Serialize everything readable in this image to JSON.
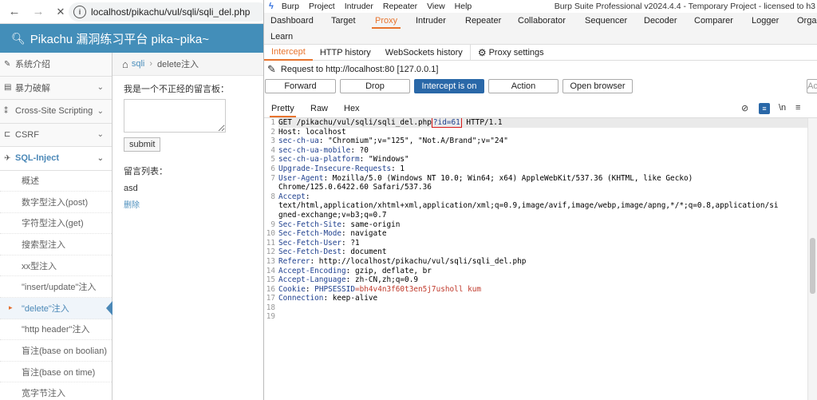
{
  "browser": {
    "back_icon": "←",
    "forward_icon": "→",
    "close_icon": "✕",
    "url": "localhost/pikachu/vul/sqli/sqli_del.php"
  },
  "site": {
    "title": "Pikachu 漏洞练习平台 pika~pika~",
    "sidebar": [
      {
        "label": "系统介绍",
        "icon": "✎",
        "chevron": false
      },
      {
        "label": "暴力破解",
        "icon": "▤",
        "chevron": true
      },
      {
        "label": "Cross-Site Scripting",
        "icon": "⁑",
        "chevron": true
      },
      {
        "label": "CSRF",
        "icon": "⊏",
        "chevron": true
      },
      {
        "label": "SQL-Inject",
        "icon": "✈",
        "chevron": true,
        "active": true
      }
    ],
    "sql_subitems": [
      "概述",
      "数字型注入(post)",
      "字符型注入(get)",
      "搜索型注入",
      "xx型注入",
      "\"insert/update\"注入",
      "\"delete\"注入",
      "\"http header\"注入",
      "盲注(base on boolian)",
      "盲注(base on time)",
      "宽字节注入"
    ],
    "breadcrumb": {
      "link": "sqli",
      "sep": "›",
      "current": "delete注入"
    },
    "form_label": "我是一个不正经的留言板：",
    "submit_label": "submit",
    "list_label": "留言列表：",
    "entry_text": "asd",
    "delete_link": "删除"
  },
  "burp": {
    "menu": [
      "Burp",
      "Project",
      "Intruder",
      "Repeater",
      "View",
      "Help"
    ],
    "window_title": "Burp Suite Professional v2024.4.4 - Temporary Project - licensed to h3",
    "top_tabs": [
      "Dashboard",
      "Target",
      "Proxy",
      "Intruder",
      "Repeater",
      "Collaborator",
      "Sequencer",
      "Decoder",
      "Comparer",
      "Logger",
      "Orga",
      "Learn"
    ],
    "active_top_tab": "Proxy",
    "sub_tabs": [
      "Intercept",
      "HTTP history",
      "WebSockets history",
      "Proxy settings"
    ],
    "request_label": "Request to http://localhost:80  [127.0.0.1]",
    "buttons": {
      "forward": "Forward",
      "drop": "Drop",
      "intercept": "Intercept is on",
      "action": "Action",
      "open_browser": "Open browser"
    },
    "view_tabs": [
      "Pretty",
      "Raw",
      "Hex"
    ],
    "view_icons": {
      "hide": "⊘",
      "wrap": "≡",
      "newline": "\\n",
      "menu": "≡"
    },
    "request_lines": [
      {
        "n": "1",
        "parts": [
          {
            "t": "GET /pikachu/vul/sqli/sqli_del.php",
            "c": "v"
          },
          {
            "t": "?id=61",
            "c": "box"
          },
          {
            "t": " HTTP/1.1",
            "c": "v"
          }
        ]
      },
      {
        "n": "2",
        "parts": [
          {
            "t": "Host: localhost",
            "c": "v"
          }
        ]
      },
      {
        "n": "3",
        "parts": [
          {
            "t": "sec-ch-ua",
            "c": "k"
          },
          {
            "t": ": \"Chromium\";v=\"125\", \"Not.A/Brand\";v=\"24\"",
            "c": "v"
          }
        ]
      },
      {
        "n": "4",
        "parts": [
          {
            "t": "sec-ch-ua-mobile",
            "c": "k"
          },
          {
            "t": ": ?0",
            "c": "v"
          }
        ]
      },
      {
        "n": "5",
        "parts": [
          {
            "t": "sec-ch-ua-platform",
            "c": "k"
          },
          {
            "t": ": \"Windows\"",
            "c": "v"
          }
        ]
      },
      {
        "n": "6",
        "parts": [
          {
            "t": "Upgrade-Insecure-Requests",
            "c": "k"
          },
          {
            "t": ": 1",
            "c": "v"
          }
        ]
      },
      {
        "n": "7",
        "parts": [
          {
            "t": "User-Agent",
            "c": "k"
          },
          {
            "t": ": Mozilla/5.0 (Windows NT 10.0; Win64; x64) AppleWebKit/537.36 (KHTML, like Gecko)",
            "c": "v"
          }
        ]
      },
      {
        "n": "",
        "parts": [
          {
            "t": "Chrome/125.0.6422.60 Safari/537.36",
            "c": "v"
          }
        ]
      },
      {
        "n": "8",
        "parts": [
          {
            "t": "Accept",
            "c": "k"
          },
          {
            "t": ":",
            "c": "v"
          }
        ]
      },
      {
        "n": "",
        "parts": [
          {
            "t": "text/html,application/xhtml+xml,application/xml;q=0.9,image/avif,image/webp,image/apng,*/*;q=0.8,application/si",
            "c": "v"
          }
        ]
      },
      {
        "n": "",
        "parts": [
          {
            "t": "gned-exchange;v=b3;q=0.7",
            "c": "v"
          }
        ]
      },
      {
        "n": "9",
        "parts": [
          {
            "t": "Sec-Fetch-Site",
            "c": "k"
          },
          {
            "t": ": same-origin",
            "c": "v"
          }
        ]
      },
      {
        "n": "10",
        "parts": [
          {
            "t": "Sec-Fetch-Mode",
            "c": "k"
          },
          {
            "t": ": navigate",
            "c": "v"
          }
        ]
      },
      {
        "n": "11",
        "parts": [
          {
            "t": "Sec-Fetch-User",
            "c": "k"
          },
          {
            "t": ": ?1",
            "c": "v"
          }
        ]
      },
      {
        "n": "12",
        "parts": [
          {
            "t": "Sec-Fetch-Dest",
            "c": "k"
          },
          {
            "t": ": document",
            "c": "v"
          }
        ]
      },
      {
        "n": "13",
        "parts": [
          {
            "t": "Referer",
            "c": "k"
          },
          {
            "t": ": http://localhost/pikachu/vul/sqli/sqli_del.php",
            "c": "v"
          }
        ]
      },
      {
        "n": "14",
        "parts": [
          {
            "t": "Accept-Encoding",
            "c": "k"
          },
          {
            "t": ": gzip, deflate, br",
            "c": "v"
          }
        ]
      },
      {
        "n": "15",
        "parts": [
          {
            "t": "Accept-Language",
            "c": "k"
          },
          {
            "t": ": zh-CN,zh;q=0.9",
            "c": "v"
          }
        ]
      },
      {
        "n": "16",
        "parts": [
          {
            "t": "Cookie",
            "c": "k"
          },
          {
            "t": ": ",
            "c": "v"
          },
          {
            "t": "PHPSESSID",
            "c": "k"
          },
          {
            "t": "=bh4v4n3f60t3en5j7usholl kum",
            "c": "ck"
          }
        ]
      },
      {
        "n": "17",
        "parts": [
          {
            "t": "Connection",
            "c": "k"
          },
          {
            "t": ": keep-alive",
            "c": "v"
          }
        ]
      },
      {
        "n": "18",
        "parts": []
      },
      {
        "n": "19",
        "parts": []
      }
    ],
    "colors": {
      "accent": "#e8742e",
      "intercept_on": "#2a68a8",
      "highlight_box": "#d91a1a"
    }
  }
}
